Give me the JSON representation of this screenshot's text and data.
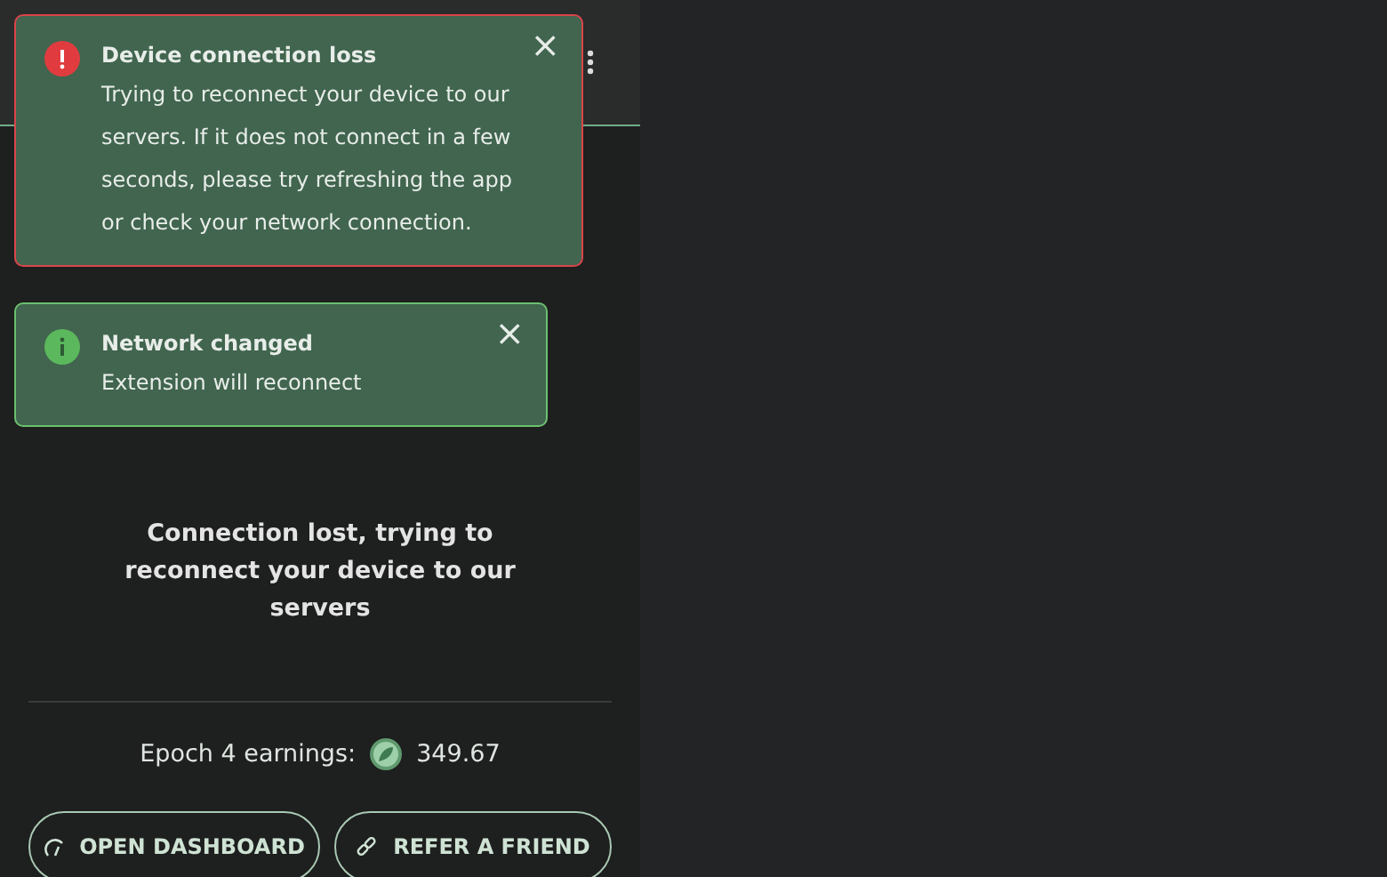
{
  "toasts": [
    {
      "kind": "error",
      "title": "Device connection loss",
      "message": "Trying to reconnect your device to our servers. If it does not connect in a few seconds, please try refreshing the app or check your network connection.",
      "close": "×"
    },
    {
      "kind": "info",
      "title": "Network changed",
      "message": "Extension will reconnect",
      "close": "×"
    }
  ],
  "status_message": "Connection lost, trying to reconnect your device to our servers",
  "earnings": {
    "label": "Epoch 4 earnings:",
    "value": "349.67"
  },
  "buttons": [
    {
      "kind": "dashboard",
      "label": "OPEN DASHBOARD"
    },
    {
      "kind": "refer",
      "label": "REFER A FRIEND"
    }
  ]
}
